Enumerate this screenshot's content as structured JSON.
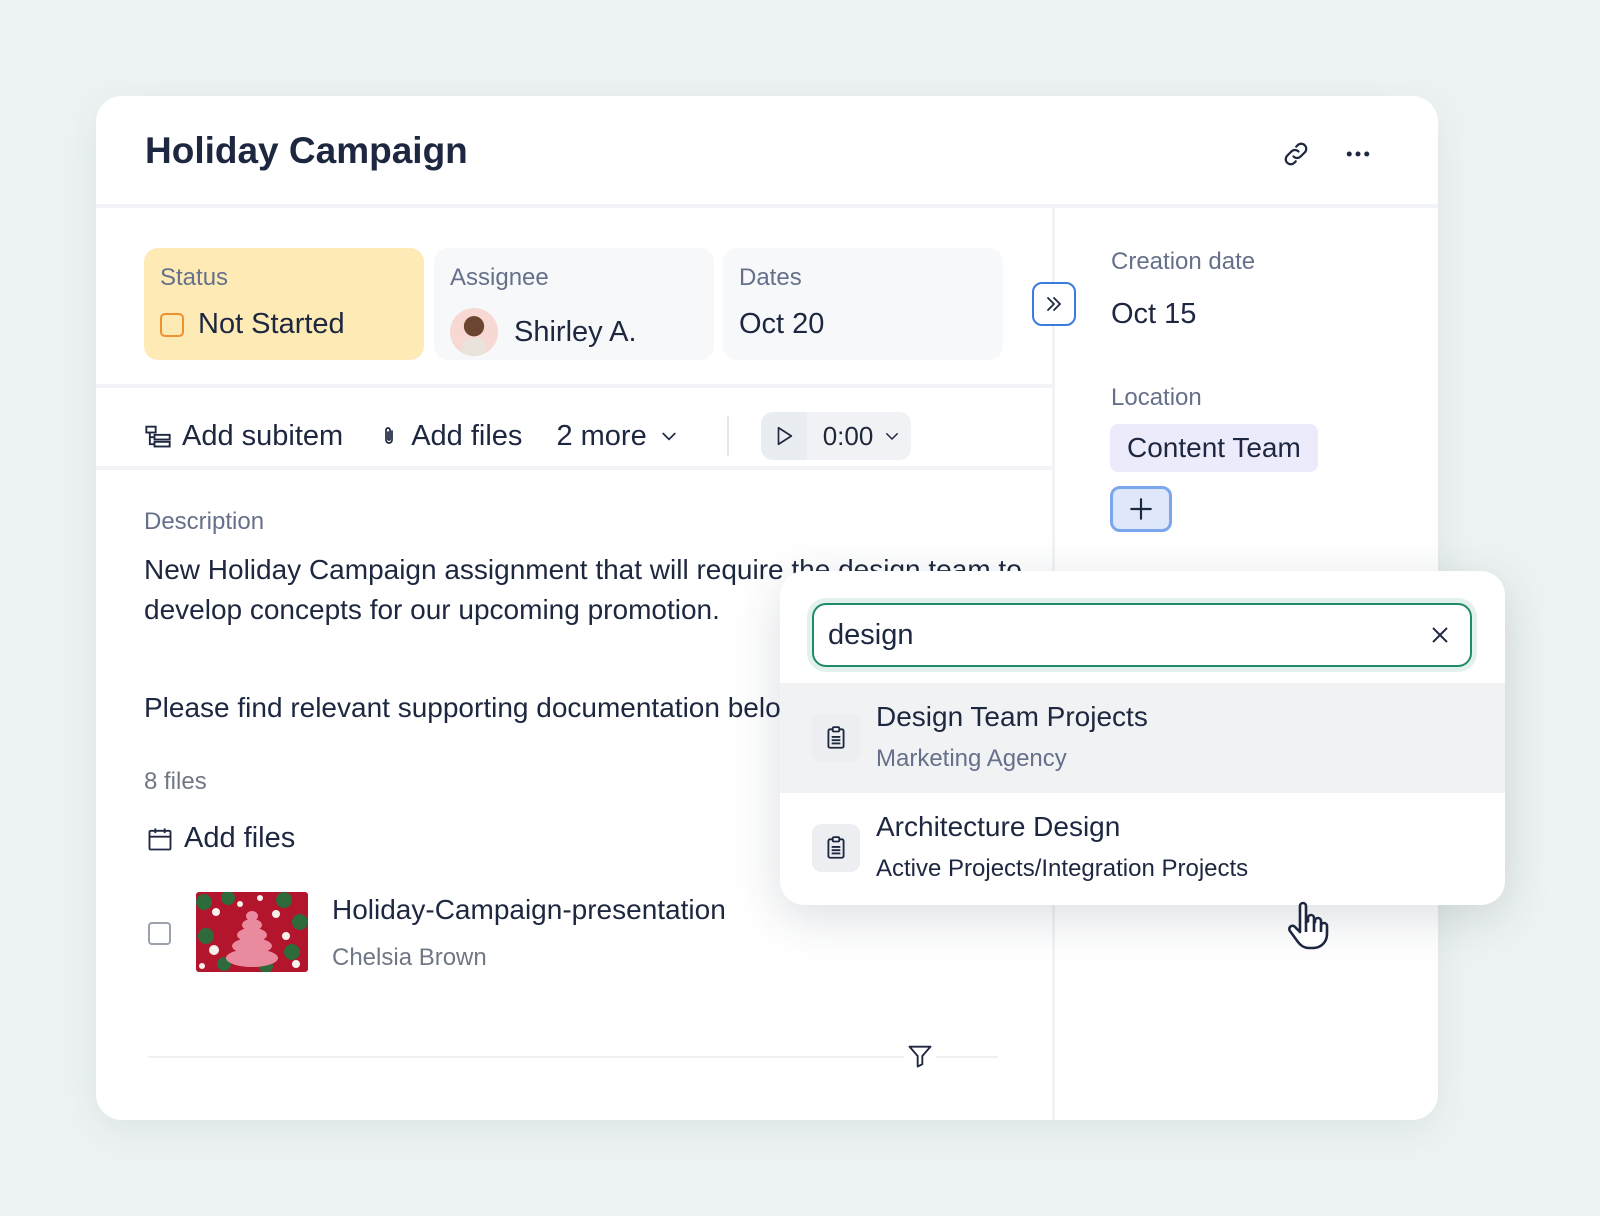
{
  "card": {
    "title": "Holiday Campaign",
    "fields": {
      "status": {
        "label": "Status",
        "value": "Not Started"
      },
      "assignee": {
        "label": "Assignee",
        "value": "Shirley A."
      },
      "dates": {
        "label": "Dates",
        "value": "Oct 20"
      }
    },
    "toolbar": {
      "add_subitem": "Add subitem",
      "add_files": "Add files",
      "more": "2 more",
      "timer": "0:00"
    },
    "description": {
      "label": "Description",
      "paragraph1": "New Holiday Campaign assignment that will require the design team to develop concepts for our upcoming promotion.",
      "paragraph2": "Please find relevant supporting documentation below."
    },
    "files": {
      "count": "8 files",
      "add_label": "Add files",
      "items": [
        {
          "name": "Holiday-Campaign-presentation",
          "owner": "Chelsia Brown"
        }
      ]
    }
  },
  "side": {
    "creation_label": "Creation date",
    "creation_value": "Oct 15",
    "location_label": "Location",
    "location_tag": "Content Team"
  },
  "popover": {
    "search_value": "design",
    "results": [
      {
        "title": "Design Team Projects",
        "subtitle": "Marketing Agency"
      },
      {
        "title": "Architecture Design",
        "subtitle": "Active Projects/Integration Projects"
      }
    ]
  },
  "icons": {
    "link": "link-icon",
    "more": "more-horizontal-icon",
    "expand": "chevrons-right-icon",
    "subitem": "subitem-icon",
    "attach": "paperclip-icon",
    "chevron": "chevron-down-icon",
    "play": "play-icon",
    "calendar": "calendar-icon",
    "filter": "filter-icon",
    "plus": "plus-icon",
    "close": "close-icon",
    "clipboard": "clipboard-icon",
    "cursor": "hand-pointer-icon"
  },
  "colors": {
    "status_bg": "#fdeab5",
    "status_accent": "#f0902e",
    "focus_green": "#1f8a6c",
    "tag_bg": "#ecebfb",
    "accent_blue": "#3b7be0"
  }
}
